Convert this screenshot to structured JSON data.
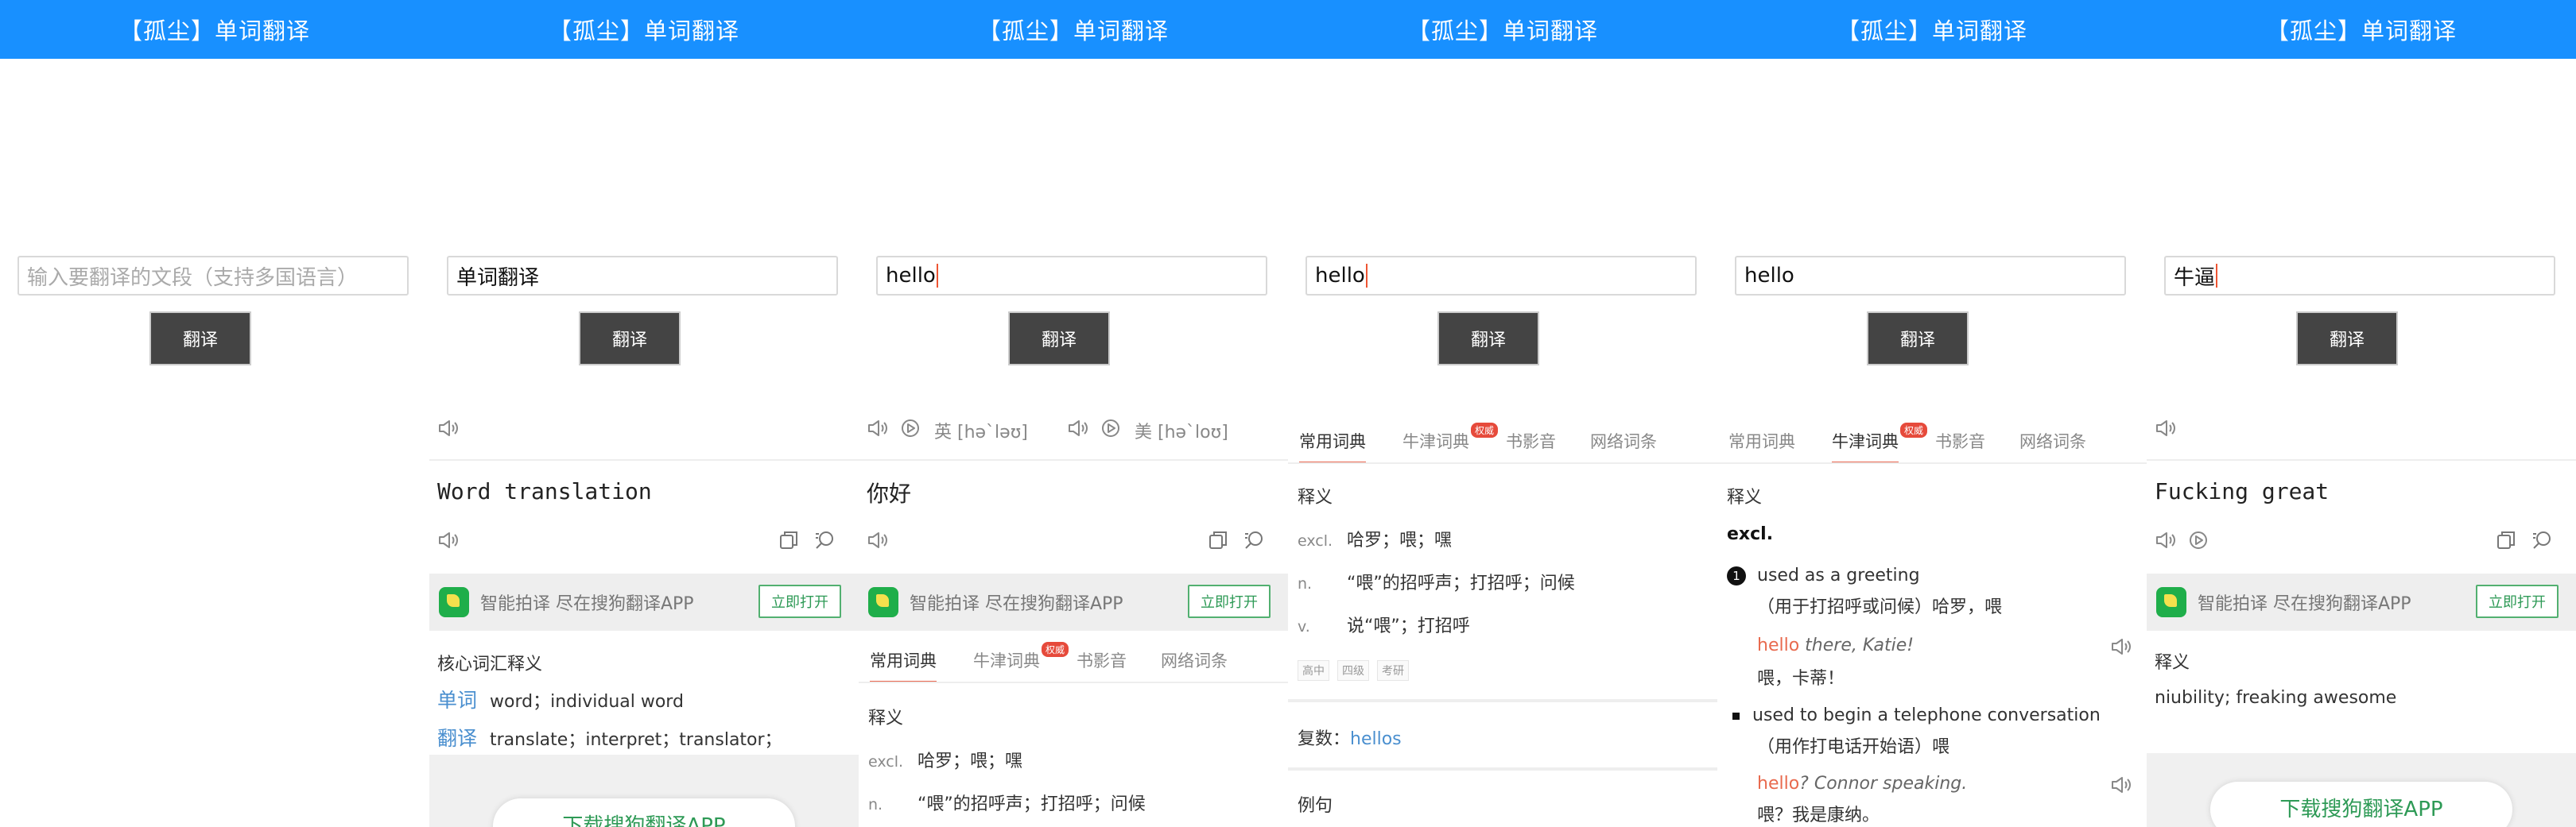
{
  "app_title": "【孤尘】单词翻译",
  "translate_label": "翻译",
  "search": {
    "placeholder": "输入要翻译的文段（支持多国语言）"
  },
  "banner": {
    "text": "智能拍译 尽在搜狗翻译APP",
    "open_label": "立即打开"
  },
  "tabs": {
    "common": "常用词典",
    "oxford": "牛津词典",
    "authority_badge": "权威",
    "book": "书影音",
    "web": "网络词条"
  },
  "download_label": "下载搜狗翻译APP",
  "panel2": {
    "input": "单词翻译",
    "result": "Word translation",
    "core_title": "核心词汇释义",
    "terms": [
      {
        "word": "单词",
        "meaning": "word；individual word"
      },
      {
        "word": "翻译",
        "meaning": "translate；interpret；translator；"
      }
    ]
  },
  "panel3": {
    "input": "hello",
    "phonetic_uk": "英 [hə`ləʊ]",
    "phonetic_us": "美 [hə`loʊ]",
    "result": "你好",
    "definition_title": "释义",
    "defs": [
      {
        "pos": "excl.",
        "text": "哈罗；喂；嘿"
      },
      {
        "pos": "n.",
        "text": "“喂”的招呼声；打招呼；问候"
      }
    ]
  },
  "panel4": {
    "input": "hello",
    "definition_title": "释义",
    "defs": [
      {
        "pos": "excl.",
        "text": "哈罗；喂；嘿"
      },
      {
        "pos": "n.",
        "text": "“喂”的招呼声；打招呼；问候"
      },
      {
        "pos": "v.",
        "text": "说“喂”；打招呼"
      }
    ],
    "tags": [
      "高中",
      "四级",
      "考研"
    ],
    "plural_label": "复数：",
    "plural_value": "hellos",
    "example_title": "例句"
  },
  "panel5": {
    "input": "hello",
    "definition_title": "释义",
    "pos": "excl.",
    "sense1_num": "1",
    "sense1": "used as a greeting",
    "sense1_cn": "（用于打招呼或问候）哈罗，喂",
    "ex1_red": "hello",
    "ex1_rest": " there, Katie!",
    "ex1_cn": "喂，卡蒂！",
    "sense2": "used to begin a telephone conversation",
    "sense2_cn": "（用作打电话开始语）喂",
    "ex2_red": "hello",
    "ex2_rest": "? Connor speaking.",
    "ex2_cn": "喂？我是康纳。"
  },
  "panel6": {
    "input": "牛逼",
    "result": "Fucking great",
    "definition_title": "释义",
    "definition": "niubility; freaking awesome"
  }
}
